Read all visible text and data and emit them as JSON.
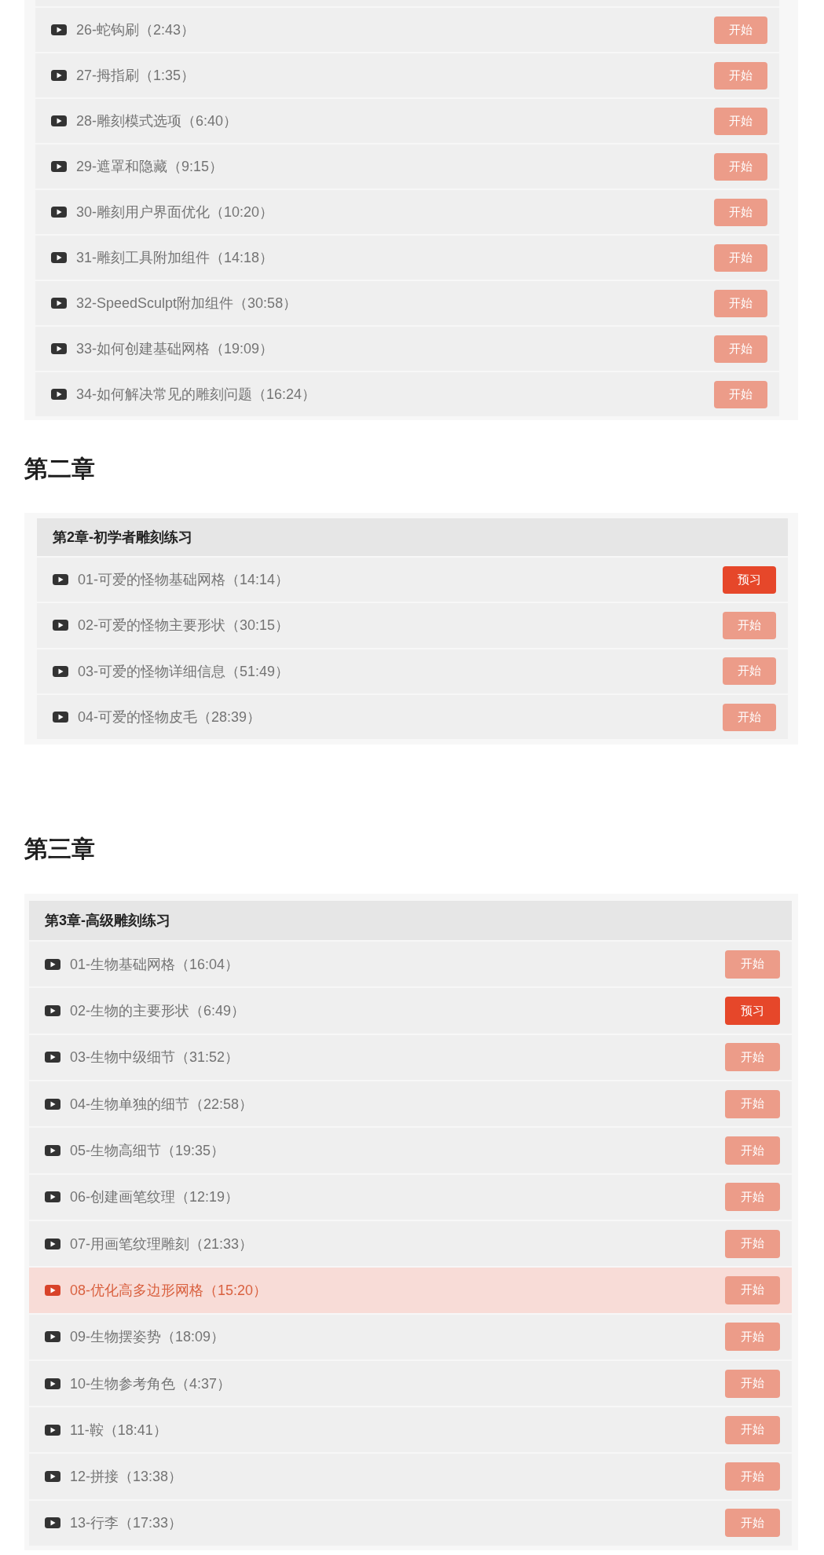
{
  "chapters": [
    {
      "lessons": [
        {
          "title": "26-蛇钩刷（2:43）",
          "selected": false,
          "button": {
            "kind": "start",
            "label": "开始"
          }
        },
        {
          "title": "27-拇指刷（1:35）",
          "selected": false,
          "button": {
            "kind": "start",
            "label": "开始"
          }
        },
        {
          "title": "28-雕刻模式选项（6:40）",
          "selected": false,
          "button": {
            "kind": "start",
            "label": "开始"
          }
        },
        {
          "title": "29-遮罩和隐藏（9:15）",
          "selected": false,
          "button": {
            "kind": "start",
            "label": "开始"
          }
        },
        {
          "title": "30-雕刻用户界面优化（10:20）",
          "selected": false,
          "button": {
            "kind": "start",
            "label": "开始"
          }
        },
        {
          "title": "31-雕刻工具附加组件（14:18）",
          "selected": false,
          "button": {
            "kind": "start",
            "label": "开始"
          }
        },
        {
          "title": "32-SpeedSculpt附加组件（30:58）",
          "selected": false,
          "button": {
            "kind": "start",
            "label": "开始"
          }
        },
        {
          "title": "33-如何创建基础网格（19:09）",
          "selected": false,
          "button": {
            "kind": "start",
            "label": "开始"
          }
        },
        {
          "title": "34-如何解决常见的雕刻问题（16:24）",
          "selected": false,
          "button": {
            "kind": "start",
            "label": "开始"
          }
        }
      ]
    },
    {
      "heading": "第二章",
      "title": "第2章-初学者雕刻练习",
      "lessons": [
        {
          "title": "01-可爱的怪物基础网格（14:14）",
          "selected": false,
          "button": {
            "kind": "preview",
            "label": "预习"
          }
        },
        {
          "title": "02-可爱的怪物主要形状（30:15）",
          "selected": false,
          "button": {
            "kind": "start",
            "label": "开始"
          }
        },
        {
          "title": "03-可爱的怪物详细信息（51:49）",
          "selected": false,
          "button": {
            "kind": "start",
            "label": "开始"
          }
        },
        {
          "title": "04-可爱的怪物皮毛（28:39）",
          "selected": false,
          "button": {
            "kind": "start",
            "label": "开始"
          }
        }
      ]
    },
    {
      "heading": "第三章",
      "title": "第3章-高级雕刻练习",
      "lessons": [
        {
          "title": "01-生物基础网格（16:04）",
          "selected": false,
          "button": {
            "kind": "start",
            "label": "开始"
          }
        },
        {
          "title": "02-生物的主要形状（6:49）",
          "selected": false,
          "button": {
            "kind": "preview",
            "label": "预习"
          }
        },
        {
          "title": "03-生物中级细节（31:52）",
          "selected": false,
          "button": {
            "kind": "start",
            "label": "开始"
          }
        },
        {
          "title": "04-生物单独的细节（22:58）",
          "selected": false,
          "button": {
            "kind": "start",
            "label": "开始"
          }
        },
        {
          "title": "05-生物高细节（19:35）",
          "selected": false,
          "button": {
            "kind": "start",
            "label": "开始"
          }
        },
        {
          "title": "06-创建画笔纹理（12:19）",
          "selected": false,
          "button": {
            "kind": "start",
            "label": "开始"
          }
        },
        {
          "title": "07-用画笔纹理雕刻（21:33）",
          "selected": false,
          "button": {
            "kind": "start",
            "label": "开始"
          }
        },
        {
          "title": "08-优化高多边形网格（15:20）",
          "selected": true,
          "button": {
            "kind": "start",
            "label": "开始"
          }
        },
        {
          "title": "09-生物摆姿势（18:09）",
          "selected": false,
          "button": {
            "kind": "start",
            "label": "开始"
          }
        },
        {
          "title": "10-生物参考角色（4:37）",
          "selected": false,
          "button": {
            "kind": "start",
            "label": "开始"
          }
        },
        {
          "title": "11-鞍（18:41）",
          "selected": false,
          "button": {
            "kind": "start",
            "label": "开始"
          }
        },
        {
          "title": "12-拼接（13:38）",
          "selected": false,
          "button": {
            "kind": "start",
            "label": "开始"
          }
        },
        {
          "title": "13-行李（17:33）",
          "selected": false,
          "button": {
            "kind": "start",
            "label": "开始"
          }
        }
      ]
    }
  ]
}
